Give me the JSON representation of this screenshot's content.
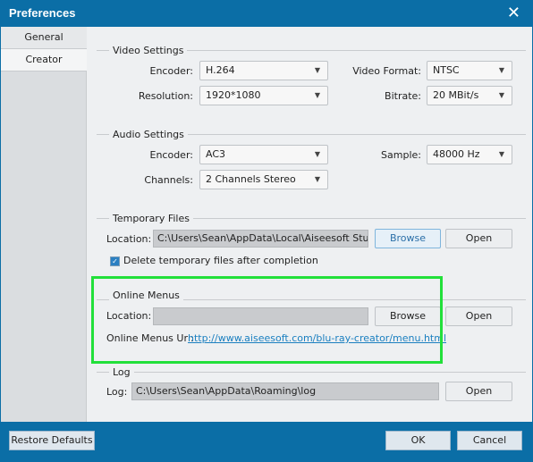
{
  "window": {
    "title": "Preferences"
  },
  "sidebar": {
    "tabs": [
      {
        "label": "General"
      },
      {
        "label": "Creator",
        "selected": true
      }
    ]
  },
  "video": {
    "title": "Video Settings",
    "encoder_label": "Encoder:",
    "encoder": "H.264",
    "format_label": "Video Format:",
    "format": "NTSC",
    "resolution_label": "Resolution:",
    "resolution": "1920*1080",
    "bitrate_label": "Bitrate:",
    "bitrate": "20 MBit/s"
  },
  "audio": {
    "title": "Audio Settings",
    "encoder_label": "Encoder:",
    "encoder": "AC3",
    "sample_label": "Sample:",
    "sample": "48000 Hz",
    "channels_label": "Channels:",
    "channels": "2 Channels Stereo"
  },
  "temp": {
    "title": "Temporary Files",
    "location_label": "Location:",
    "location": "C:\\Users\\Sean\\AppData\\Local\\Aiseesoft Studio\\A",
    "browse": "Browse",
    "open": "Open",
    "delete_label": "Delete temporary files after completion",
    "delete_checked": true
  },
  "online": {
    "title": "Online Menus",
    "location_label": "Location:",
    "location": "",
    "browse": "Browse",
    "open": "Open",
    "url_label": "Online Menus Url:",
    "url": "http://www.aiseesoft.com/blu-ray-creator/menu.html"
  },
  "log": {
    "title": "Log",
    "label": "Log:",
    "value": "C:\\Users\\Sean\\AppData\\Roaming\\log",
    "open": "Open"
  },
  "footer": {
    "restore": "Restore Defaults",
    "ok": "OK",
    "cancel": "Cancel"
  },
  "colors": {
    "titlebar": "#0b6ea6",
    "highlight": "#22e03a",
    "link": "#1a7fc0"
  }
}
